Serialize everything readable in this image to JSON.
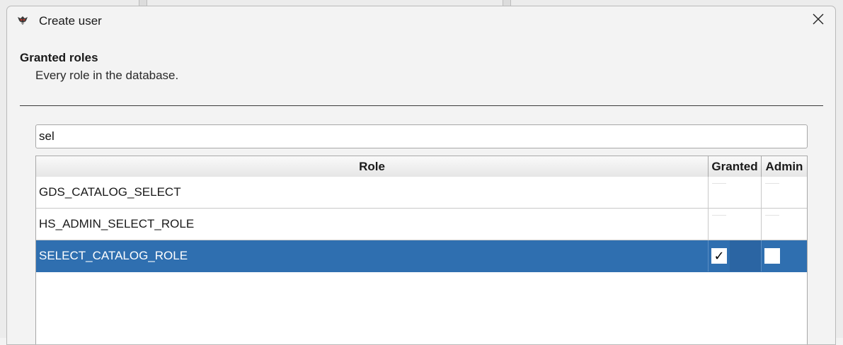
{
  "window": {
    "title": "Create user",
    "close_icon": "close-icon",
    "app_icon": "app-logo-icon"
  },
  "header": {
    "title": "Granted roles",
    "description": "Every role in the database."
  },
  "search": {
    "value": "sel"
  },
  "table": {
    "columns": [
      "Role",
      "Granted",
      "Admin"
    ],
    "rows": [
      {
        "role": "GDS_CATALOG_SELECT",
        "granted": false,
        "admin": false,
        "selected": false
      },
      {
        "role": "HS_ADMIN_SELECT_ROLE",
        "granted": false,
        "admin": false,
        "selected": false
      },
      {
        "role": "SELECT_CATALOG_ROLE",
        "granted": true,
        "admin": false,
        "selected": true
      }
    ],
    "checkmark": "✓"
  },
  "colors": {
    "selection": "#2f6fb0",
    "background": "#f3f3f3"
  }
}
